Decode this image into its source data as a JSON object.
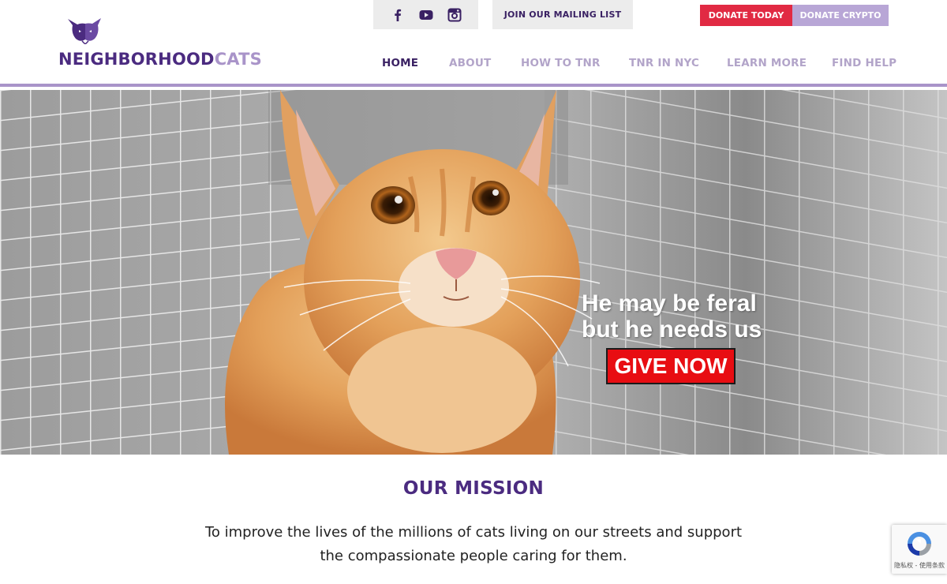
{
  "brand": {
    "name_part1": "NEIGHBORHOOD",
    "name_part2": "CATS",
    "primary_color": "#4b2b80",
    "secondary_color": "#a994c9"
  },
  "social": [
    {
      "icon": "facebook-icon"
    },
    {
      "icon": "youtube-icon"
    },
    {
      "icon": "instagram-icon"
    }
  ],
  "header_buttons": {
    "mailing_list": "JOIN OUR MAILING LIST",
    "donate_today": "DONATE TODAY",
    "donate_crypto": "DONATE CRYPTO"
  },
  "colors": {
    "donate": "#e12a43",
    "crypto": "#b8a6d6",
    "give_now": "#e80d12"
  },
  "nav": {
    "items": [
      {
        "label": "HOME",
        "active": true
      },
      {
        "label": "ABOUT",
        "active": false
      },
      {
        "label": "HOW TO TNR",
        "active": false
      },
      {
        "label": "TNR IN NYC",
        "active": false
      },
      {
        "label": "LEARN MORE",
        "active": false
      },
      {
        "label": "FIND HELP",
        "active": false
      }
    ]
  },
  "hero": {
    "line1": "He may be feral",
    "line2": "but he needs us",
    "cta": "GIVE NOW"
  },
  "mission": {
    "title": "OUR MISSION",
    "text": "To improve the lives of the millions of cats living on our streets and support the compassionate people caring for them."
  },
  "recaptcha": {
    "links": "隐私权 - 使用条款"
  }
}
